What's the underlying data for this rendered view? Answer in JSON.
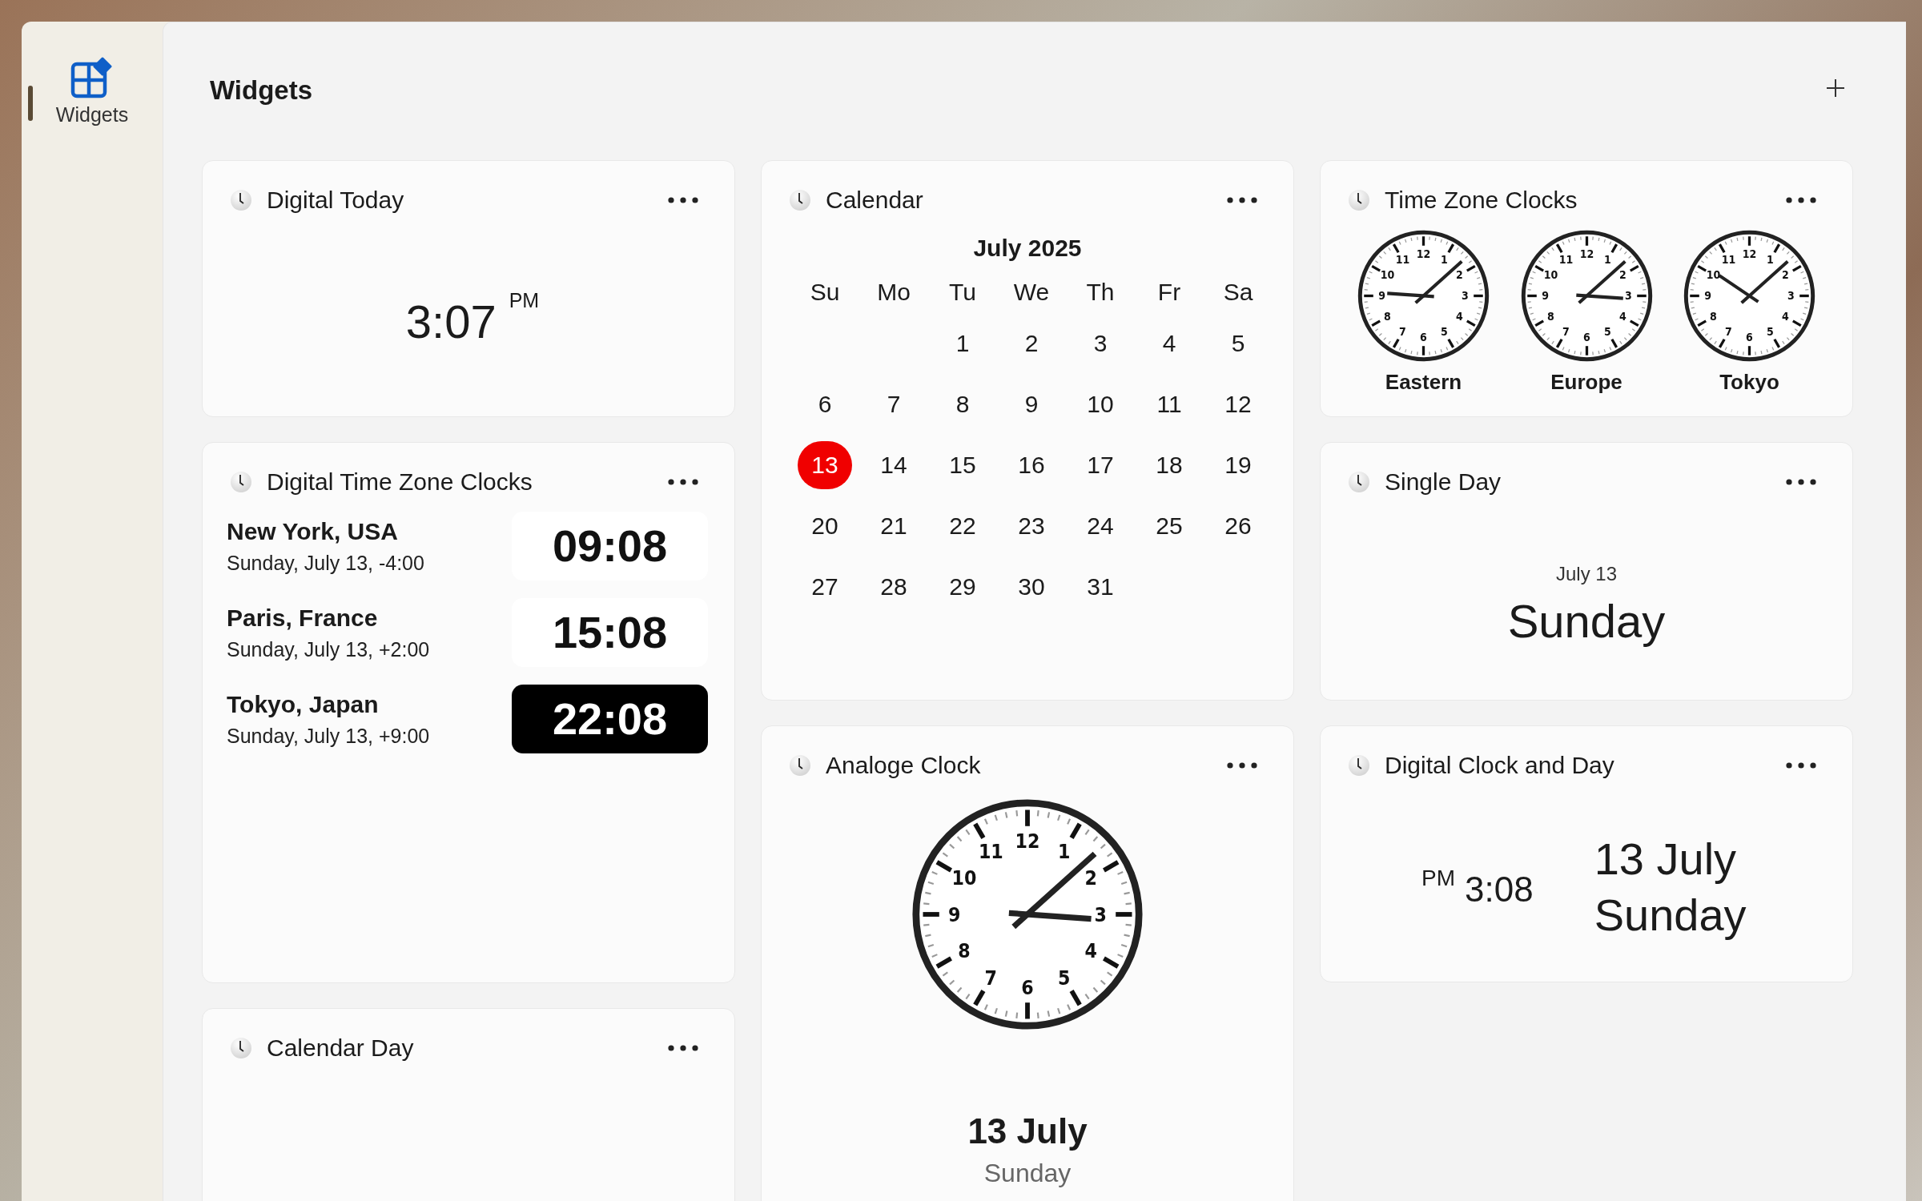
{
  "sidebar": {
    "items": [
      {
        "label": "Widgets",
        "selected": true
      }
    ]
  },
  "header": {
    "title": "Widgets"
  },
  "columns": [
    [
      {
        "kind": "digital_today",
        "title": "Digital Today",
        "time": "3:07",
        "period": "PM"
      },
      {
        "kind": "digital_zones",
        "title": "Digital Time Zone Clocks",
        "zones": [
          {
            "city": "New York, USA",
            "detail": "Sunday, July 13, -4:00",
            "time": "09:08",
            "highlighted": false
          },
          {
            "city": "Paris, France",
            "detail": "Sunday, July 13, +2:00",
            "time": "15:08",
            "highlighted": false
          },
          {
            "city": "Tokyo, Japan",
            "detail": "Sunday, July 13, +9:00",
            "time": "22:08",
            "highlighted": true
          }
        ]
      },
      {
        "kind": "calendar_day",
        "title": "Calendar Day"
      }
    ],
    [
      {
        "kind": "calendar",
        "title": "Calendar",
        "month": "July 2025",
        "weekdays": [
          "Su",
          "Mo",
          "Tu",
          "We",
          "Th",
          "Fr",
          "Sa"
        ],
        "weeks": [
          {
            "days": [
              {
                "label": "1",
                "selected": false
              },
              {
                "label": "2",
                "selected": false
              },
              {
                "label": "3",
                "selected": false
              },
              {
                "label": "4",
                "selected": false
              },
              {
                "label": "5",
                "selected": false
              }
            ]
          },
          {
            "days": [
              {
                "label": "6",
                "selected": false
              },
              {
                "label": "7",
                "selected": false
              },
              {
                "label": "8",
                "selected": false
              },
              {
                "label": "9",
                "selected": false
              },
              {
                "label": "10",
                "selected": false
              },
              {
                "label": "11",
                "selected": false
              },
              {
                "label": "12",
                "selected": false
              }
            ]
          },
          {
            "days": [
              {
                "label": "13",
                "selected": true
              },
              {
                "label": "14",
                "selected": false
              },
              {
                "label": "15",
                "selected": false
              },
              {
                "label": "16",
                "selected": false
              },
              {
                "label": "17",
                "selected": false
              },
              {
                "label": "18",
                "selected": false
              },
              {
                "label": "19",
                "selected": false
              }
            ]
          },
          {
            "days": [
              {
                "label": "20",
                "selected": false
              },
              {
                "label": "21",
                "selected": false
              },
              {
                "label": "22",
                "selected": false
              },
              {
                "label": "23",
                "selected": false
              },
              {
                "label": "24",
                "selected": false
              },
              {
                "label": "25",
                "selected": false
              },
              {
                "label": "26",
                "selected": false
              }
            ]
          },
          {
            "days": [
              {
                "label": "27",
                "selected": false
              },
              {
                "label": "28",
                "selected": false
              },
              {
                "label": "29",
                "selected": false
              },
              {
                "label": "30",
                "selected": false
              },
              {
                "label": "31",
                "selected": false
              }
            ]
          }
        ]
      },
      {
        "kind": "analog",
        "title": "Analoge Clock",
        "numerals": [
          "12",
          "11",
          "1",
          "10",
          "2",
          "9",
          "3",
          "8",
          "4",
          "7",
          "5",
          "6"
        ],
        "date": "13 July",
        "weekday": "Sunday"
      }
    ],
    [
      {
        "kind": "zone_clocks",
        "title": "Time Zone Clocks",
        "clocks": [
          {
            "label": "Eastern",
            "numerals": [
              "12",
              "11",
              "1",
              "10",
              "2",
              "9",
              "3",
              "8",
              "4",
              "7",
              "5",
              "6"
            ]
          },
          {
            "label": "Europe",
            "numerals": [
              "12",
              "11",
              "1",
              "10",
              "2",
              "9",
              "3",
              "8",
              "4",
              "7",
              "5",
              "6"
            ]
          },
          {
            "label": "Tokyo",
            "numerals": [
              "12",
              "11",
              "1",
              "10",
              "2",
              "9",
              "3",
              "8",
              "4",
              "7",
              "5",
              "6"
            ]
          }
        ]
      },
      {
        "kind": "single_day",
        "title": "Single Day",
        "date": "July 13",
        "weekday": "Sunday"
      },
      {
        "kind": "clock_day",
        "title": "Digital Clock and Day",
        "period": "PM",
        "time": "3:08",
        "date": "13 July",
        "weekday": "Sunday"
      }
    ]
  ]
}
